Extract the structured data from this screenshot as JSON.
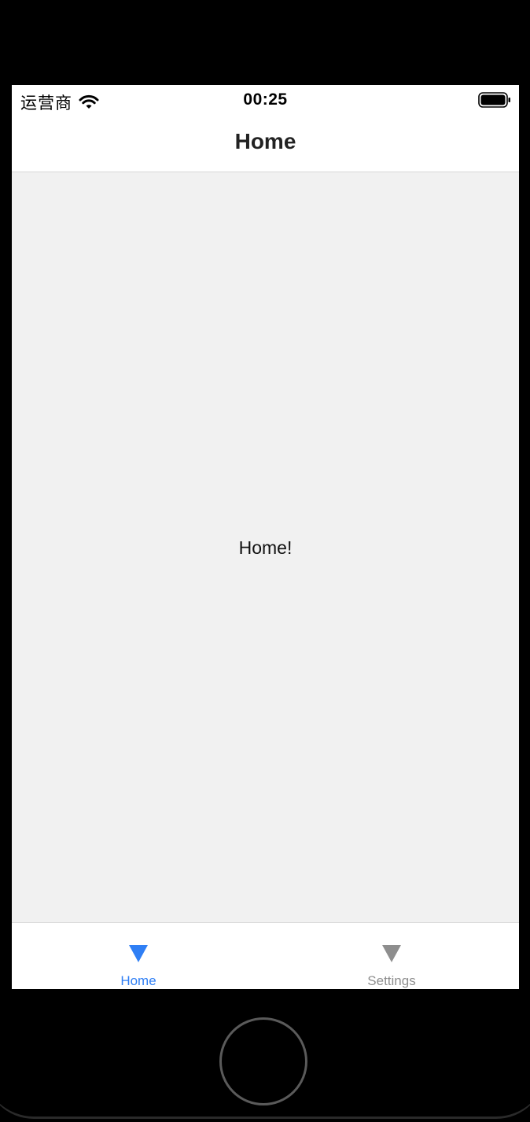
{
  "status_bar": {
    "carrier": "运营商",
    "time": "00:25",
    "wifi_icon": "wifi-icon",
    "battery_icon": "battery-full-icon"
  },
  "nav": {
    "title": "Home"
  },
  "content": {
    "text": "Home!"
  },
  "tabs": [
    {
      "label": "Home",
      "icon": "triangle-down-icon",
      "active": true,
      "color": "#2f7ff5"
    },
    {
      "label": "Settings",
      "icon": "triangle-down-icon",
      "active": false,
      "color": "#8e8e8e"
    }
  ],
  "colors": {
    "active_tab": "#2f7ff5",
    "inactive_tab": "#8e8e8e",
    "content_background": "#f1f1f1",
    "device_frame": "#000000"
  }
}
